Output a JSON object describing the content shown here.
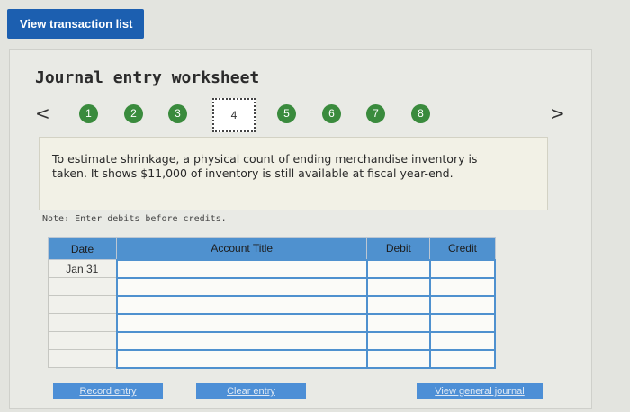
{
  "top_button": "View transaction list",
  "worksheet": {
    "title": "Journal entry worksheet",
    "prev_arrow": "<",
    "next_arrow": ">",
    "steps": [
      "1",
      "2",
      "3",
      "4",
      "5",
      "6",
      "7",
      "8"
    ],
    "current_step": "4",
    "description_line1": "To estimate shrinkage, a physical count of ending merchandise inventory is",
    "description_line2": "taken. It shows $11,000 of inventory is still available at fiscal year-end.",
    "note": "Note: Enter debits before credits."
  },
  "table": {
    "headers": [
      "Date",
      "Account Title",
      "Debit",
      "Credit"
    ],
    "rows": [
      {
        "date": "Jan 31",
        "account": "",
        "debit": "",
        "credit": ""
      },
      {
        "date": "",
        "account": "",
        "debit": "",
        "credit": ""
      },
      {
        "date": "",
        "account": "",
        "debit": "",
        "credit": ""
      },
      {
        "date": "",
        "account": "",
        "debit": "",
        "credit": ""
      },
      {
        "date": "",
        "account": "",
        "debit": "",
        "credit": ""
      },
      {
        "date": "",
        "account": "",
        "debit": "",
        "credit": ""
      }
    ]
  },
  "buttons": {
    "record": "Record entry",
    "clear": "Clear entry",
    "view_general": "View general journal"
  },
  "colors": {
    "primary_blue": "#1c5fb0",
    "table_header": "#4f91cf",
    "step_green": "#3a8b3d"
  }
}
